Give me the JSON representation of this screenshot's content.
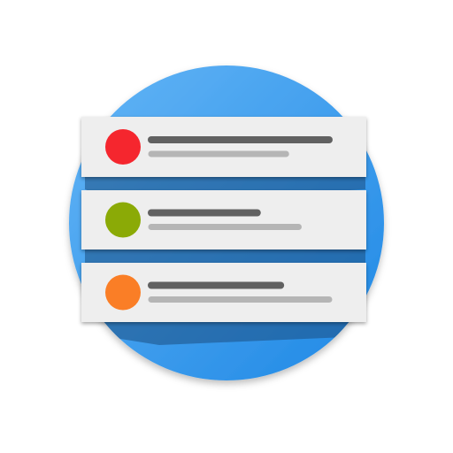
{
  "icon": {
    "name": "list-notification-icon",
    "colors": {
      "circle_light": "#64B5F6",
      "circle_dark": "#1E88E5",
      "card": "#EEEEEE",
      "line_dark": "#616161",
      "line_light": "#B5B5B5",
      "shadow": "#1B4F82"
    },
    "items": [
      {
        "name": "list-item-red",
        "dot_color": "#F5262E",
        "title_fill": 0.99,
        "subtitle_fill": 0.75
      },
      {
        "name": "list-item-green",
        "dot_color": "#8BAA06",
        "title_fill": 0.59,
        "subtitle_fill": 0.82
      },
      {
        "name": "list-item-orange",
        "dot_color": "#FA7E26",
        "title_fill": 0.72,
        "subtitle_fill": 0.99
      }
    ]
  }
}
